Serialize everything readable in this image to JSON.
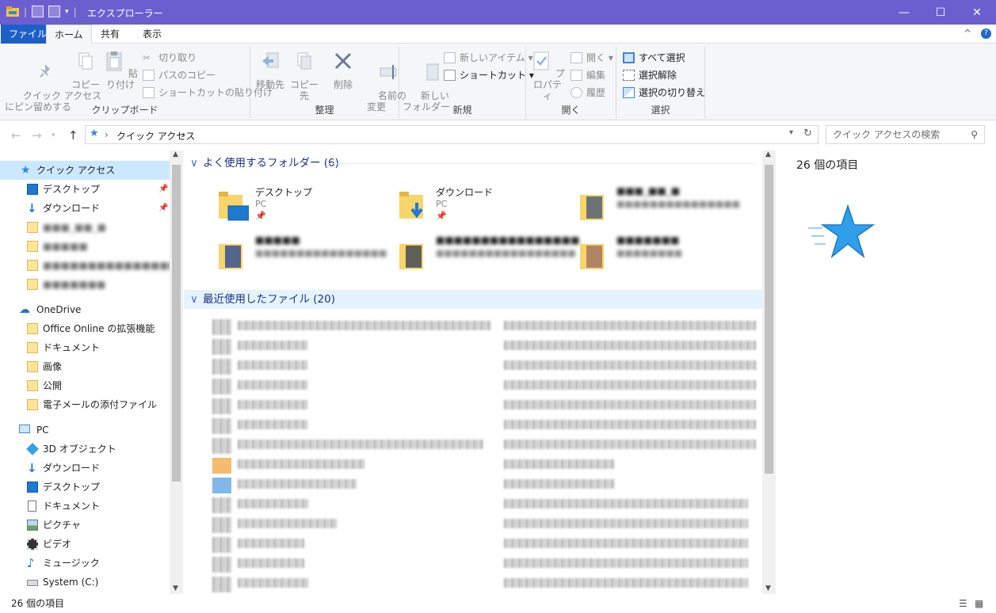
{
  "window": {
    "title": "エクスプローラー",
    "minimize": "—",
    "maximize": "☐",
    "close": "✕"
  },
  "tabs": {
    "file": "ファイル",
    "home": "ホーム",
    "share": "共有",
    "view": "表示"
  },
  "ribbon": {
    "clipboard": {
      "label": "クリップボード",
      "pin": "クイック アクセス\nにピン留めする",
      "copy": "コピー",
      "paste": "貼り付け",
      "cut": "切り取り",
      "copy_path": "パスのコピー",
      "paste_shortcut": "ショートカットの貼り付け"
    },
    "organize": {
      "label": "整理",
      "move_to": "移動先",
      "copy_to": "コピー先",
      "delete": "削除",
      "rename": "名前の\n変更"
    },
    "new": {
      "label": "新規",
      "new_folder": "新しい\nフォルダー",
      "new_item": "新しいアイテム",
      "easy_access": "ショートカット"
    },
    "open": {
      "label": "開く",
      "properties": "プロパティ",
      "open": "開く",
      "edit": "編集",
      "history": "履歴"
    },
    "select": {
      "label": "選択",
      "select_all": "すべて選択",
      "select_none": "選択解除",
      "invert": "選択の切り替え"
    }
  },
  "address": {
    "path": "クイック アクセス",
    "search_placeholder": "クイック アクセスの検索"
  },
  "nav": {
    "quick_access": "クイック アクセス",
    "qa_items": [
      "デスクトップ",
      "ダウンロード",
      "■■■_■■_■",
      "■■■■■",
      "■■■■■■■■■■■■■■■■",
      "■■■■■■■"
    ],
    "onedrive": "OneDrive",
    "od_items": [
      "Office Online の拡張機能",
      "ドキュメント",
      "画像",
      "公開",
      "電子メールの添付ファイル"
    ],
    "pc": "PC",
    "pc_items": [
      "3D オブジェクト",
      "ダウンロード",
      "デスクトップ",
      "ドキュメント",
      "ピクチャ",
      "ビデオ",
      "ミュージック",
      "System (C:)"
    ]
  },
  "frequent": {
    "header": "よく使用するフォルダー (6)",
    "items": [
      {
        "name": "デスクトップ",
        "sub": "PC"
      },
      {
        "name": "ダウンロード",
        "sub": "PC"
      },
      {
        "name": "■■■_■■_■",
        "sub": "■■■■■■■■■■■■■■■"
      },
      {
        "name": "■■■■■",
        "sub": "■■■■■■■■■■■■■■■■"
      },
      {
        "name": "■■■■■■■■■■■■■■■■",
        "sub": "■■■■■■■■■■■■■■■■■"
      },
      {
        "name": "■■■■■■■",
        "sub": "■■■■■■■■"
      }
    ]
  },
  "recent": {
    "header": "最近使用したファイル (20)"
  },
  "preview": {
    "count": "26 個の項目"
  },
  "status": {
    "count": "26 個の項目"
  },
  "colors": {
    "titlebar": "#6b5fd0",
    "accent": "#1e5ec8",
    "selection": "#cce8ff"
  }
}
